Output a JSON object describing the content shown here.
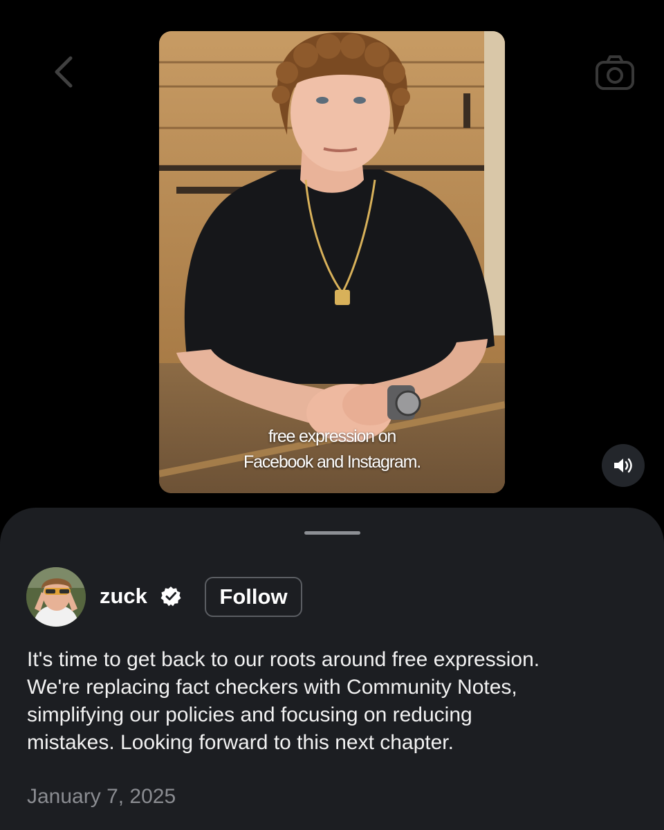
{
  "video": {
    "caption_lines": [
      "free expression on",
      "Facebook and Instagram."
    ]
  },
  "icons": {
    "back": "chevron-left-icon",
    "camera": "camera-icon",
    "sound": "speaker-icon",
    "verified": "verified-badge-icon"
  },
  "post": {
    "username": "zuck",
    "verified": true,
    "follow_label": "Follow",
    "text_lines": [
      "It's time to get back to our roots around free expression.",
      "We're replacing fact checkers with Community Notes,",
      "simplifying our policies and focusing on reducing",
      "mistakes. Looking forward to this next chapter."
    ],
    "date": "January 7, 2025"
  },
  "colors": {
    "background": "#000000",
    "sheet": "#1c1e22",
    "text": "#f2f2f2",
    "muted": "#8b8d92",
    "button_border": "#5b5e63"
  }
}
